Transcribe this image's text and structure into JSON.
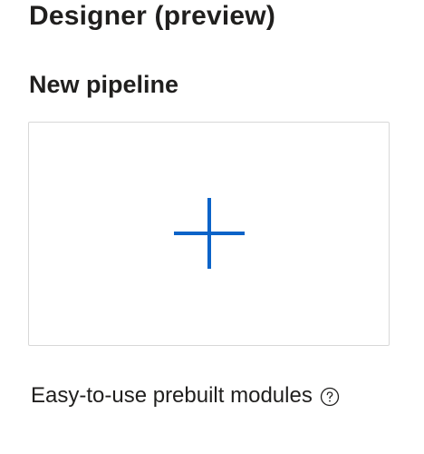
{
  "header": {
    "title": "Designer (preview)"
  },
  "section": {
    "title": "New pipeline"
  },
  "tile": {
    "icon": "plus-icon",
    "accent_color": "#0b63c8",
    "caption": "Easy-to-use prebuilt modules",
    "help_icon": "question-circle-icon"
  }
}
